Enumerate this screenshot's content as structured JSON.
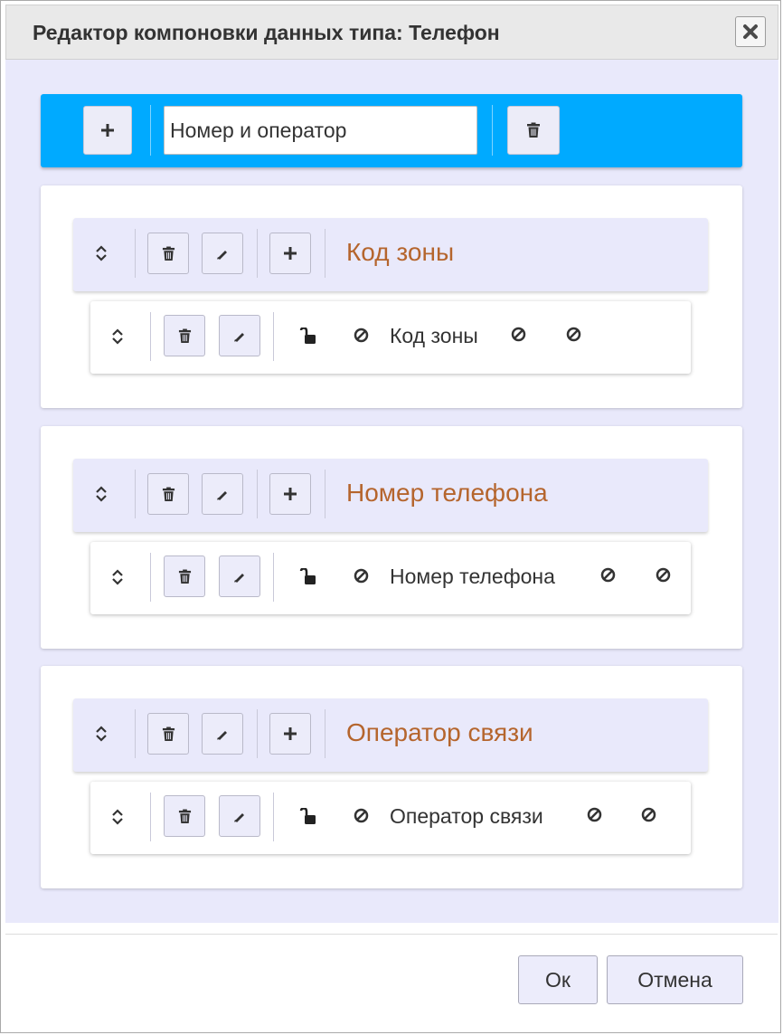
{
  "dialog": {
    "title": "Редактор компоновки данных типа: Телефон",
    "close_icon": "close-icon"
  },
  "top_bar": {
    "accent_color": "#00aaff",
    "add_icon": "plus-icon",
    "name_value": "Номер и оператор",
    "delete_icon": "trash-icon"
  },
  "groups": [
    {
      "title": "Код зоны",
      "item": {
        "label": "Код зоны"
      }
    },
    {
      "title": "Номер телефона",
      "item": {
        "label": "Номер телефона"
      }
    },
    {
      "title": "Оператор связи",
      "item": {
        "label": "Оператор связи"
      }
    }
  ],
  "colors": {
    "group_title": "#b5652d",
    "body_bg": "#e9e9fb"
  },
  "footer": {
    "ok_label": "Ок",
    "cancel_label": "Отмена"
  }
}
